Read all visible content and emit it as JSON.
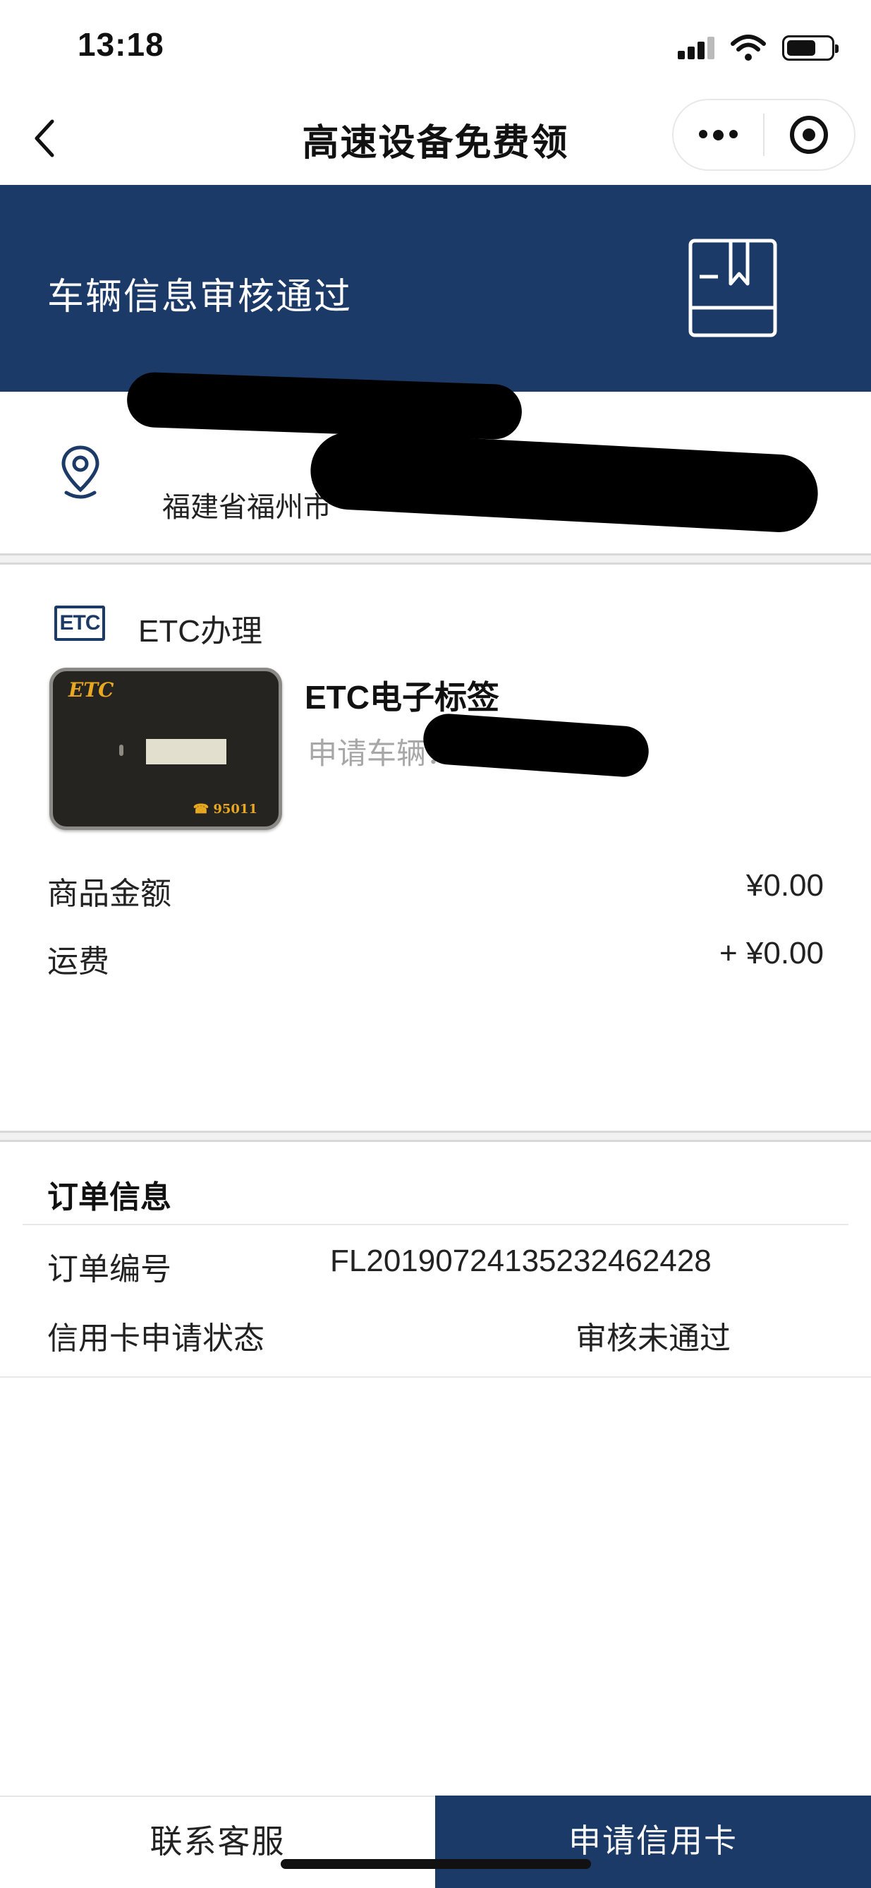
{
  "status_bar": {
    "time": "13:18"
  },
  "nav": {
    "title": "高速设备免费领",
    "back_icon": "chevron-left-icon",
    "more_icon": "more-dots-icon",
    "close_icon": "target-circle-icon"
  },
  "banner": {
    "text": "车辆信息审核通过",
    "icon": "bookmark-book-icon",
    "color": "#1b3a68"
  },
  "address": {
    "icon": "location-pin-icon",
    "text": "福建省福州市"
  },
  "etc": {
    "section_title": "ETC办理",
    "badge": "ETC",
    "card_logo": "ETC",
    "card_phone": "☎ 95011",
    "product_name": "ETC电子标签",
    "vehicle_label": "申请车辆："
  },
  "pricing": {
    "goods_label": "商品金额",
    "goods_value": "¥0.00",
    "shipping_label": "运费",
    "shipping_value": "+ ¥0.00"
  },
  "order": {
    "title": "订单信息",
    "number_label": "订单编号",
    "number_value": "FL20190724135232462428",
    "credit_status_label": "信用卡申请状态",
    "credit_status_value": "审核未通过"
  },
  "bottom_bar": {
    "contact_label": "联系客服",
    "apply_label": "申请信用卡"
  }
}
